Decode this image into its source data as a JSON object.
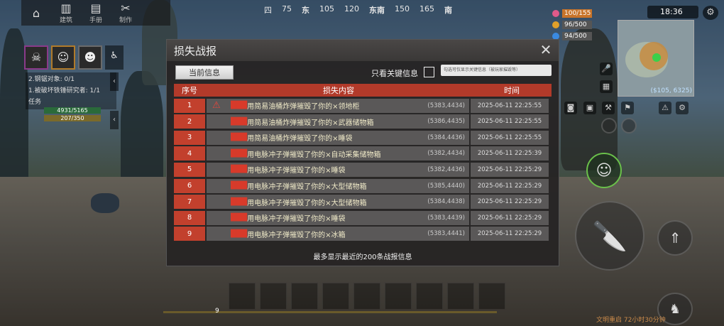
{
  "topbar": {
    "items": [
      {
        "icon": "home-icon",
        "label": ""
      },
      {
        "icon": "building-icon",
        "label": "建筑"
      },
      {
        "icon": "book-icon",
        "label": "手册"
      },
      {
        "icon": "craft-icon",
        "label": "制作"
      }
    ],
    "compass": [
      "四",
      "75",
      "东",
      "105",
      "120",
      "东南",
      "150",
      "165",
      "南"
    ]
  },
  "status": {
    "food": "100/155",
    "energy": "96/500",
    "water": "94/500",
    "clock": "18:36"
  },
  "minimap": {
    "coord": "($105, 6325)"
  },
  "quests": {
    "line1": "2.钢锯对象: 0/1",
    "line2": "1.被破坏铁锤研究者: 1/1",
    "task_label": "任务",
    "hp": "4931/5165",
    "xp": "207/350"
  },
  "dialog": {
    "title": "损失战报",
    "tab_current": "当前信息",
    "key_only_label": "只看关键信息",
    "hint": "勾选可仅显示关键信息（被玩家摧毁等）",
    "headers": {
      "no": "序号",
      "content": "损失内容",
      "time": "时间"
    },
    "rows": [
      {
        "no": "1",
        "attacker": "███",
        "msg": "用简易油桶炸弹摧毁了你的×领地柜",
        "coord": "(5383,4434)",
        "time": "2025-06-11 22:25:55",
        "warn": true
      },
      {
        "no": "2",
        "attacker": "███",
        "msg": "用简易油桶炸弹摧毁了你的×武器储物箱",
        "coord": "(5386,4435)",
        "time": "2025-06-11 22:25:55",
        "warn": false
      },
      {
        "no": "3",
        "attacker": "███",
        "msg": "用简易油桶炸弹摧毁了你的×睡袋",
        "coord": "(5384,4436)",
        "time": "2025-06-11 22:25:55",
        "warn": false
      },
      {
        "no": "4",
        "attacker": "███",
        "msg": "用电脉冲子弹摧毁了你的×自动采集储物箱",
        "coord": "(5382,4434)",
        "time": "2025-06-11 22:25:39",
        "warn": false
      },
      {
        "no": "5",
        "attacker": "███",
        "msg": "用电脉冲子弹摧毁了你的×睡袋",
        "coord": "(5382,4436)",
        "time": "2025-06-11 22:25:29",
        "warn": false
      },
      {
        "no": "6",
        "attacker": "███",
        "msg": "用电脉冲子弹摧毁了你的×大型储物箱",
        "coord": "(5385,4440)",
        "time": "2025-06-11 22:25:29",
        "warn": false
      },
      {
        "no": "7",
        "attacker": "███",
        "msg": "用电脉冲子弹摧毁了你的×大型储物箱",
        "coord": "(5384,4438)",
        "time": "2025-06-11 22:25:29",
        "warn": false
      },
      {
        "no": "8",
        "attacker": "███",
        "msg": "用电脉冲子弹摧毁了你的×睡袋",
        "coord": "(5383,4439)",
        "time": "2025-06-11 22:25:29",
        "warn": false
      },
      {
        "no": "9",
        "attacker": "███",
        "msg": "用电脉冲子弹摧毁了你的×冰箱",
        "coord": "(5383,4441)",
        "time": "2025-06-11 22:25:29",
        "warn": false
      }
    ],
    "footer": "最多显示最近的200条战报信息"
  },
  "hotbar": {
    "level": "9"
  },
  "bottom_note": "文明重启 72小时30分钟",
  "colors": {
    "accent_red": "#c2402d",
    "header_red": "#b23a2a",
    "attacker_red": "#d83a2a"
  }
}
